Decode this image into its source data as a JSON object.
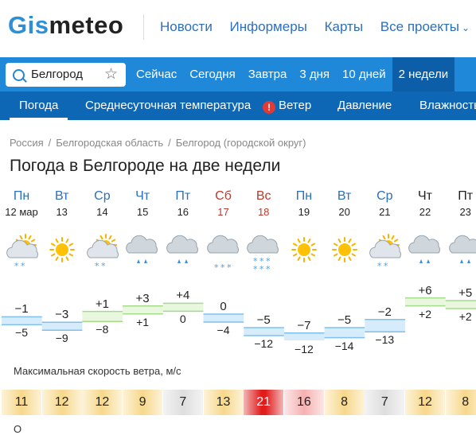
{
  "header": {
    "logo_part1": "Gis",
    "logo_part2": "meteo",
    "nav": [
      "Новости",
      "Информеры",
      "Карты",
      "Все проекты"
    ]
  },
  "search": {
    "value": "Белгород"
  },
  "periods": [
    "Сейчас",
    "Сегодня",
    "Завтра",
    "3 дня",
    "10 дней",
    "2 недели"
  ],
  "active_period_index": 5,
  "tabs": [
    "Погода",
    "Среднесуточная температура",
    "Ветер",
    "Давление",
    "Влажность"
  ],
  "breadcrumbs": [
    "Россия",
    "Белгородская область",
    "Белгород (городской округ)"
  ],
  "page_title": "Погода в Белгороде на две недели",
  "days": [
    {
      "dow": "Пн",
      "date": "12 мар",
      "weekend": false,
      "icon": "partly-cloudy-snow",
      "hi": "−1",
      "lo": "−5",
      "wind": "11"
    },
    {
      "dow": "Вт",
      "date": "13",
      "weekend": false,
      "icon": "sunny",
      "hi": "−3",
      "lo": "−9",
      "wind": "12"
    },
    {
      "dow": "Ср",
      "date": "14",
      "weekend": false,
      "icon": "partly-cloudy-snow",
      "hi": "+1",
      "lo": "−8",
      "wind": "12"
    },
    {
      "dow": "Чт",
      "date": "15",
      "weekend": false,
      "icon": "cloud-rain",
      "hi": "+3",
      "lo": "+1",
      "wind": "9"
    },
    {
      "dow": "Пт",
      "date": "16",
      "weekend": false,
      "icon": "cloud-rain",
      "hi": "+4",
      "lo": "0",
      "wind": "7"
    },
    {
      "dow": "Сб",
      "date": "17",
      "weekend": true,
      "icon": "cloud-snow",
      "hi": "0",
      "lo": "−4",
      "wind": "13"
    },
    {
      "dow": "Вс",
      "date": "18",
      "weekend": true,
      "icon": "cloud-heavy-snow",
      "hi": "−5",
      "lo": "−12",
      "wind": "21"
    },
    {
      "dow": "Пн",
      "date": "19",
      "weekend": false,
      "icon": "sunny",
      "hi": "−7",
      "lo": "−12",
      "wind": "16"
    },
    {
      "dow": "Вт",
      "date": "20",
      "weekend": false,
      "icon": "sunny",
      "hi": "−5",
      "lo": "−14",
      "wind": "8"
    },
    {
      "dow": "Ср",
      "date": "21",
      "weekend": false,
      "icon": "partly-cloudy-snow",
      "hi": "−2",
      "lo": "−13",
      "wind": "7"
    },
    {
      "dow": "Чт",
      "date": "22",
      "weekend": false,
      "icon": "cloud-rain",
      "hi": "+6",
      "lo": "+2",
      "wind": "12"
    },
    {
      "dow": "Пт",
      "date": "23",
      "weekend": false,
      "icon": "cloud-rain",
      "hi": "+5",
      "lo": "+2",
      "wind": "8"
    }
  ],
  "wind_title": "Максимальная скорость ветра, м/с",
  "bottom_text": "О",
  "colors": {
    "brand": "#1f88d9",
    "brand_dark": "#0e67b4",
    "link": "#2d6fb8",
    "weekend": "#c0392b",
    "warn": "#e53935"
  }
}
